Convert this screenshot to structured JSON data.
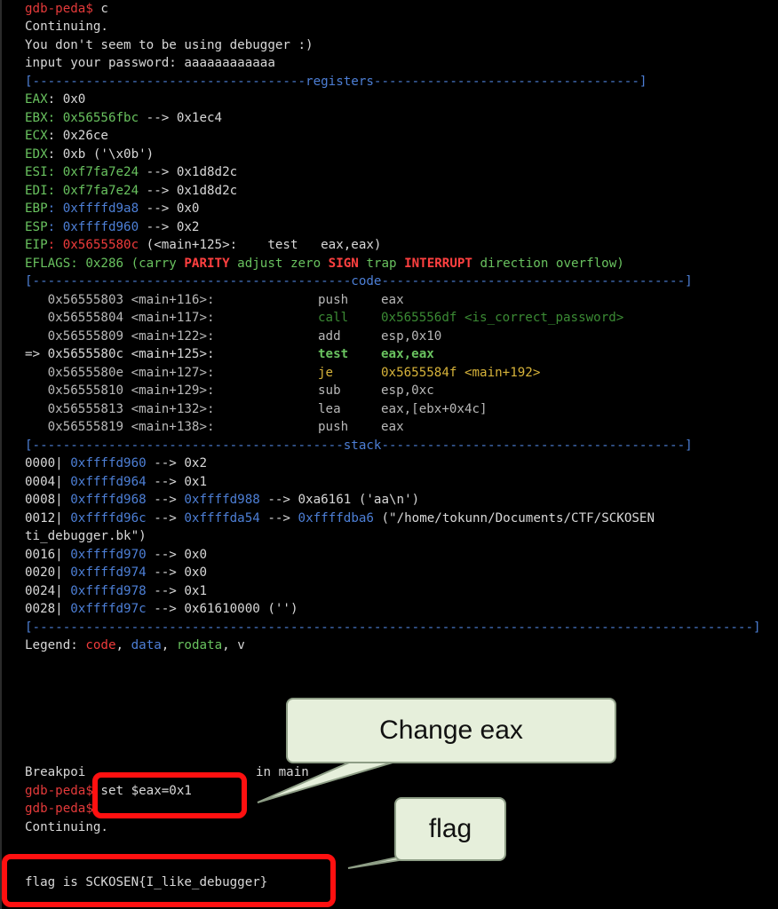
{
  "terminal": {
    "prompt": "gdb-peda$",
    "lines": {
      "l1": {
        "cmd": " c"
      },
      "l2": {
        "text": "Continuing."
      },
      "l3": {
        "text": "You don't seem to be using debugger :)"
      },
      "l4": {
        "text": "input your password: aaaaaaaaaaaa"
      },
      "l5": {
        "left": "[------------------------------------",
        "label": "registers",
        "right": "-----------------------------------]"
      },
      "l6": {
        "name": "EAX",
        "rest": ": 0x0"
      },
      "l7": {
        "name": "EBX",
        "v1": ": 0x56556fbc",
        "rest": " --> 0x1ec4"
      },
      "l8": {
        "name": "ECX",
        "rest": ": 0x26ce"
      },
      "l9": {
        "name": "EDX",
        "rest": ": 0xb ('\\x0b')"
      },
      "l10": {
        "name": "ESI",
        "v1": ": 0xf7fa7e24",
        "rest": " --> 0x1d8d2c"
      },
      "l11": {
        "name": "EDI",
        "v1": ": 0xf7fa7e24",
        "rest": " --> 0x1d8d2c"
      },
      "l12": {
        "name": "EBP",
        "v1": ": 0xffffd9a8",
        "rest": " --> 0x0"
      },
      "l13": {
        "name": "ESP",
        "v1": ": 0xffffd960",
        "rest": " --> 0x2"
      },
      "l14": {
        "name": "EIP",
        "v1": ": 0x5655580c",
        "rest": " (<main+125>:    test   eax,eax)"
      },
      "l15": {
        "name": "EFLAGS",
        "a": ": 0x286 (",
        "b": "carry ",
        "c": "PARITY",
        "d": " adjust zero ",
        "e": "SIGN",
        "f": " trap ",
        "g": "INTERRUPT",
        "h": " direction overflow",
        "i": ")"
      },
      "l16": {
        "left": "[------------------------------------------",
        "label": "code",
        "right": "----------------------------------------]"
      },
      "l17": {
        "addr": "   0x56555803 <main+116>:",
        "op": "push",
        "arg": "eax"
      },
      "l18": {
        "addr": "   0x56555804 <main+117>:",
        "op": "call",
        "arg": "0x565556df <is_correct_password>"
      },
      "l19": {
        "addr": "   0x56555809 <main+122>:",
        "op": "add",
        "arg": "esp,0x10"
      },
      "l20": {
        "addr": "=> 0x5655580c <main+125>:",
        "op": "test",
        "arg": "eax,eax"
      },
      "l21": {
        "addr": "   0x5655580e <main+127>:",
        "op": "je",
        "arg": "0x5655584f <main+192>"
      },
      "l22": {
        "addr": "   0x56555810 <main+129>:",
        "op": "sub",
        "arg": "esp,0xc"
      },
      "l23": {
        "addr": "   0x56555813 <main+132>:",
        "op": "lea",
        "arg": "eax,[ebx+0x4c]"
      },
      "l24": {
        "addr": "   0x56555819 <main+138>:",
        "op": "push",
        "arg": "eax"
      },
      "l25": {
        "left": "[-----------------------------------------",
        "label": "stack",
        "right": "----------------------------------------]"
      },
      "l26": {
        "off": "0000| ",
        "a": "0xffffd960",
        "b": " --> 0x2"
      },
      "l27": {
        "off": "0004| ",
        "a": "0xffffd964",
        "b": " --> 0x1"
      },
      "l28": {
        "off": "0008| ",
        "a": "0xffffd968",
        "b": " --> ",
        "c": "0xffffd988",
        "d": " --> 0xa6161 ('aa\\n')"
      },
      "l29": {
        "off": "0012| ",
        "a": "0xffffd96c",
        "b": " --> ",
        "c": "0xffffda54",
        "d": " --> ",
        "e": "0xffffdba6",
        "f": " (\"/home/tokunn/Documents/CTF/SCKOSEN"
      },
      "l30": {
        "text": "ti_debugger.bk\")"
      },
      "l31": {
        "off": "0016| ",
        "a": "0xffffd970",
        "b": " --> 0x0"
      },
      "l32": {
        "off": "0020| ",
        "a": "0xffffd974",
        "b": " --> 0x0"
      },
      "l33": {
        "off": "0024| ",
        "a": "0xffffd978",
        "b": " --> 0x1"
      },
      "l34": {
        "off": "0028| ",
        "a": "0xffffd97c",
        "b": " --> 0x61610000 ('')"
      },
      "l35": {
        "left": "[-----------------------------------------------------------------------------------------------]"
      },
      "l36": {
        "a": "Legend: ",
        "b": "code",
        "c": ", ",
        "d": "data",
        "e": ", ",
        "f": "rodata",
        "g": ", v"
      },
      "l38": {
        "a": "Breakpoi",
        "b": "in main"
      },
      "l39": {
        "cmd": " set $eax=0x1"
      },
      "l41": {
        "text": "Continuing."
      },
      "l43": {
        "text": "flag is SCKOSEN{I_like_debugger}"
      }
    }
  },
  "callouts": {
    "change_eax": "Change eax",
    "flag": "flag"
  }
}
